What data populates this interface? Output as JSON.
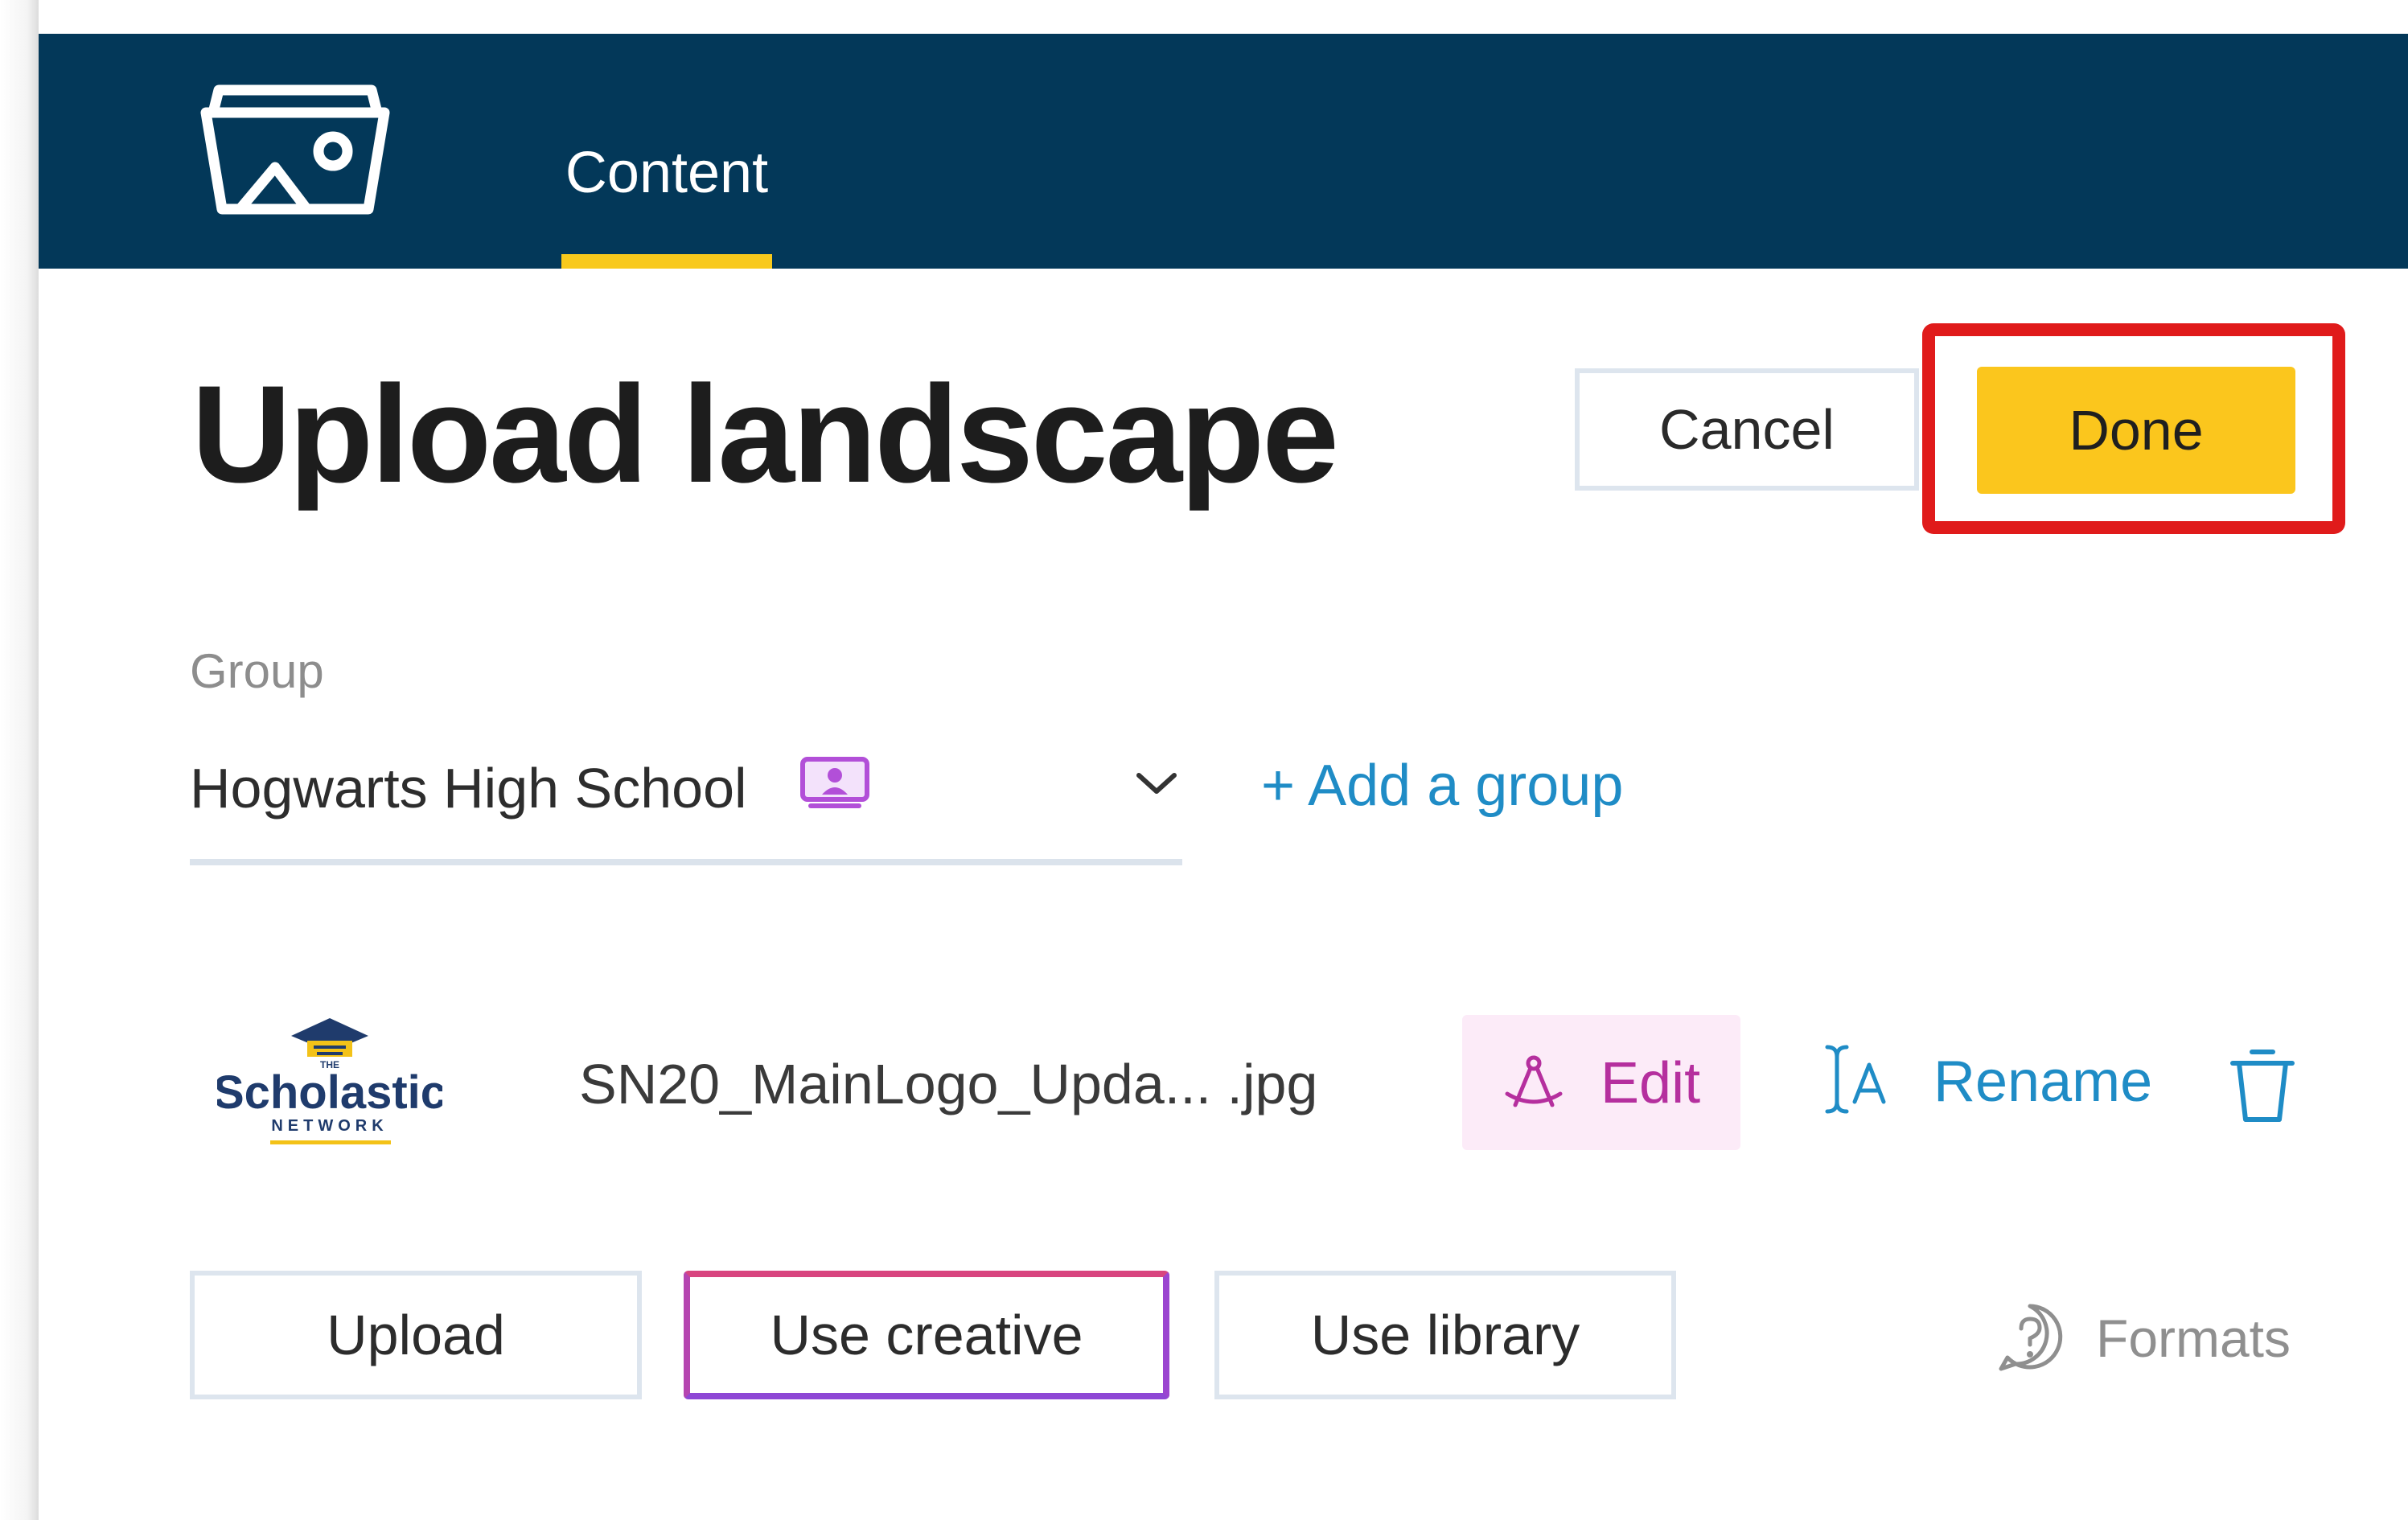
{
  "header": {
    "logo_icon": "media-gallery-icon",
    "tabs": [
      {
        "label": "Content",
        "active": true
      }
    ],
    "accent_color": "#f8c91c",
    "background_color": "#033859"
  },
  "page": {
    "title": "Upload landscape",
    "actions": {
      "cancel_label": "Cancel",
      "done_label": "Done"
    }
  },
  "group": {
    "label": "Group",
    "selected": "Hogwarts High School",
    "selected_icon": "presenter-screen-icon",
    "add_label": "+ Add a group"
  },
  "file": {
    "thumbnail_icon": "scholastic-network-logo",
    "thumbnail_text": {
      "wordmark": "Scholastic",
      "subtitle": "NETWORK",
      "small": "THE"
    },
    "name": "SN20_MainLogo_Upda... .jpg",
    "edit_label": "Edit",
    "rename_label": "Rename"
  },
  "sources": {
    "upload_label": "Upload",
    "creative_label": "Use creative",
    "library_label": "Use library",
    "formats_label": "Formats"
  },
  "highlight": {
    "target": "Done",
    "color": "#e01b1b"
  }
}
